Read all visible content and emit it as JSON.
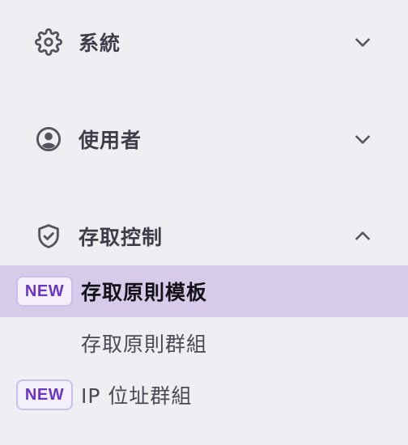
{
  "sections": [
    {
      "label": "系統",
      "icon": "gear-icon",
      "expanded": false
    },
    {
      "label": "使用者",
      "icon": "user-circle-icon",
      "expanded": false
    },
    {
      "label": "存取控制",
      "icon": "shield-check-icon",
      "expanded": true
    }
  ],
  "access_control_items": [
    {
      "label": "存取原則模板",
      "badge": "NEW",
      "active": true
    },
    {
      "label": "存取原則群組",
      "badge": null,
      "active": false
    },
    {
      "label": "IP 位址群組",
      "badge": "NEW",
      "active": false
    }
  ],
  "colors": {
    "background": "#efeef3",
    "active_item_bg": "#d6cce9",
    "badge_text": "#6a35c8",
    "badge_border": "#cbbdf0",
    "icon_color": "#55535d"
  }
}
